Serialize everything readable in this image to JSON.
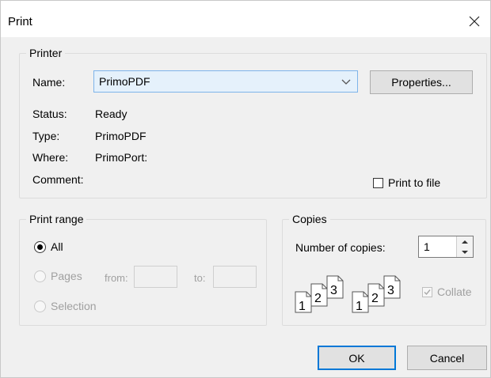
{
  "window": {
    "title": "Print",
    "close_glyph": "✕"
  },
  "printer": {
    "legend": "Printer",
    "name_label": "Name:",
    "name_value": "PrimoPDF",
    "properties_label": "Properties...",
    "status_label": "Status:",
    "status_value": "Ready",
    "type_label": "Type:",
    "type_value": "PrimoPDF",
    "where_label": "Where:",
    "where_value": "PrimoPort:",
    "comment_label": "Comment:",
    "print_to_file_label": "Print to file"
  },
  "print_range": {
    "legend": "Print range",
    "all_label": "All",
    "pages_label": "Pages",
    "from_label": "from:",
    "to_label": "to:",
    "selection_label": "Selection",
    "selected": "All"
  },
  "copies": {
    "legend": "Copies",
    "number_label": "Number of copies:",
    "number_value": "1",
    "collate_label": "Collate",
    "collate_checked": true,
    "page_numbers": [
      "1",
      "2",
      "3"
    ]
  },
  "buttons": {
    "ok": "OK",
    "cancel": "Cancel"
  },
  "colors": {
    "accent": "#0078d7",
    "select_bg": "#e5f1fb",
    "dialog_bg": "#f0f0f0"
  }
}
